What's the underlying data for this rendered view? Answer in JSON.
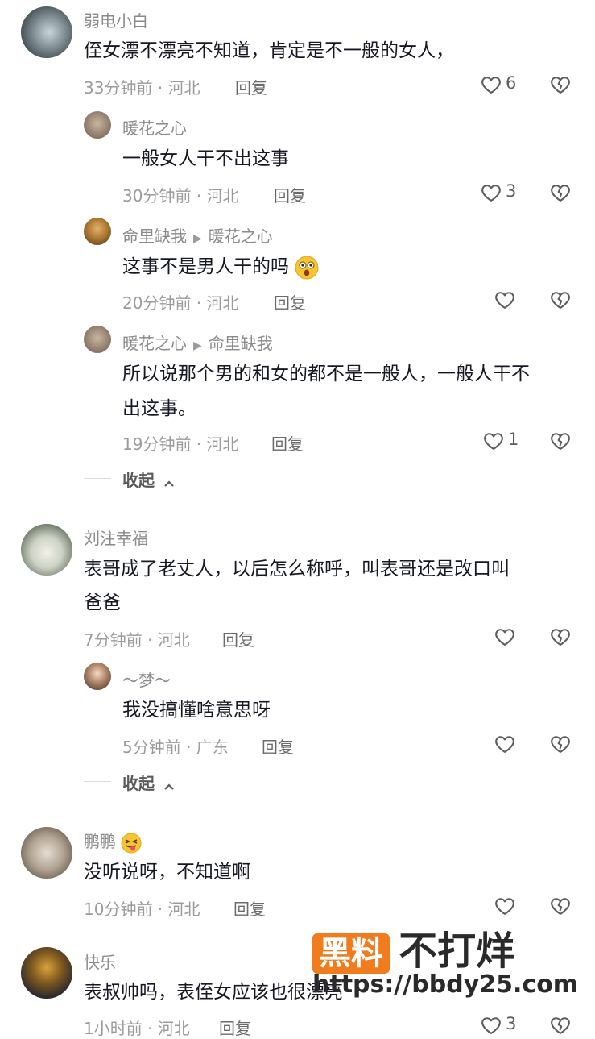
{
  "comments": [
    {
      "user": "弱电小白",
      "text": "侄女漂不漂亮不知道，肯定是不一般的女人，",
      "time_loc": "33分钟前 · 河北",
      "reply_label": "回复",
      "likes": "6",
      "replies": [
        {
          "user": "暖花之心",
          "text": "一般女人干不出这事",
          "time_loc": "30分钟前 · 河北",
          "reply_label": "回复",
          "likes": "3"
        },
        {
          "user": "命里缺我",
          "reply_to": "暖花之心",
          "text": "这事不是男人干的吗",
          "time_loc": "20分钟前 · 河北",
          "reply_label": "回复",
          "likes": ""
        },
        {
          "user": "暖花之心",
          "reply_to": "命里缺我",
          "text_line1": "所以说那个男的和女的都不是一般人，一般人干不",
          "text_line2": "出这事。",
          "time_loc": "19分钟前 · 河北",
          "reply_label": "回复",
          "likes": "1"
        }
      ],
      "collapse_label": "收起"
    },
    {
      "user": "刘注幸福",
      "text_line1": "表哥成了老丈人，以后怎么称呼，叫表哥还是改口叫",
      "text_line2": "爸爸",
      "time_loc": "7分钟前 · 河北",
      "reply_label": "回复",
      "likes": "",
      "replies": [
        {
          "user": "～梦～",
          "text": "我没搞懂啥意思呀",
          "time_loc": "5分钟前 · 广东",
          "reply_label": "回复",
          "likes": ""
        }
      ],
      "collapse_label": "收起"
    },
    {
      "user": "鹏鹏",
      "text": "没听说呀，不知道啊",
      "time_loc": "10分钟前 · 河北",
      "reply_label": "回复",
      "likes": ""
    },
    {
      "user": "快乐",
      "text": "表叔帅吗，表侄女应该也很漂亮",
      "time_loc": "1小时前 · 河北",
      "reply_label": "回复",
      "likes": "3"
    }
  ],
  "watermark": {
    "box_text": "黑料",
    "main_text": "不打烊",
    "url": "https://bbdy25.com"
  },
  "colors": {
    "accent": "#f07c1e",
    "text": "#161823",
    "meta": "#9b9b9b"
  }
}
